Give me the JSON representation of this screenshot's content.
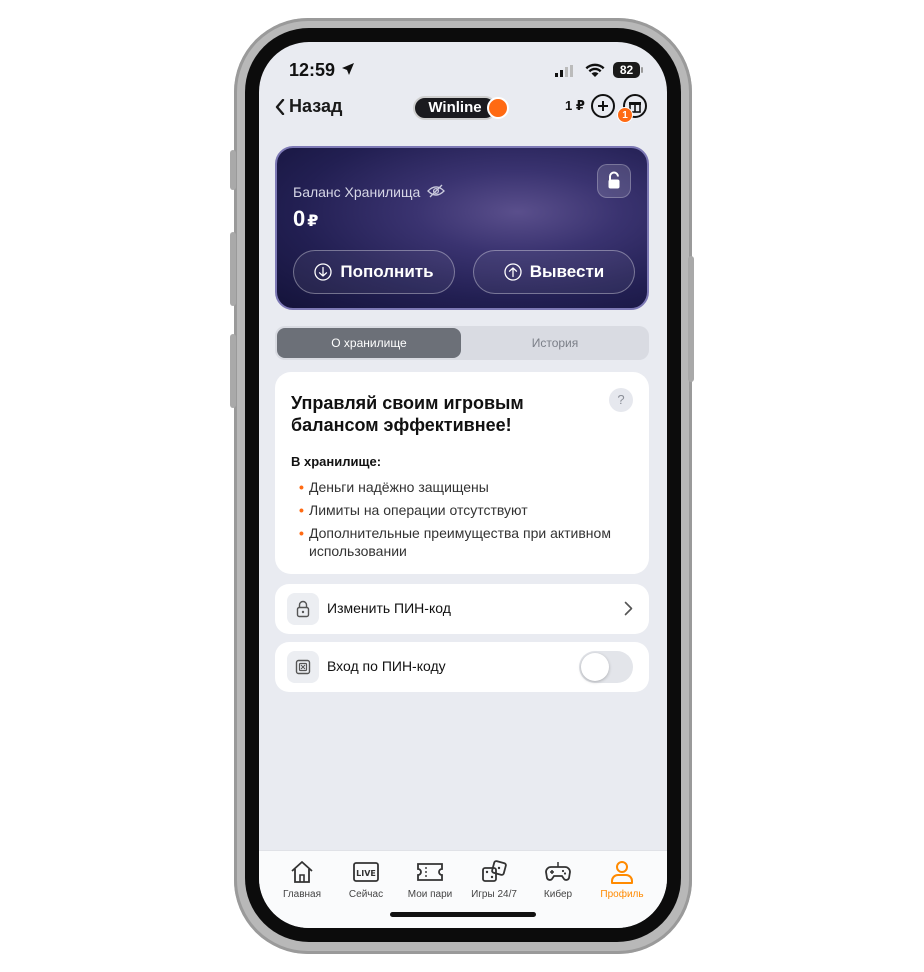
{
  "status_bar": {
    "time": "12:59",
    "battery": "82"
  },
  "header": {
    "back_label": "Назад",
    "logo_text": "Winline",
    "balance": "1 ₽",
    "notification_count": "1"
  },
  "vault": {
    "label": "Баланс Хранилища",
    "amount": "0",
    "currency": "₽",
    "deposit_label": "Пополнить",
    "withdraw_label": "Вывести"
  },
  "tabs": [
    {
      "label": "О хранилище",
      "active": true
    },
    {
      "label": "История",
      "active": false
    }
  ],
  "info": {
    "title": "Управляй своим игровым балансом эффективнее!",
    "help": "?",
    "subtitle": "В хранилище:",
    "items": [
      "Деньги надёжно защищены",
      "Лимиты на операции отсутствуют",
      "Дополнительные преимущества при активном использовании"
    ]
  },
  "settings": {
    "change_pin_label": "Изменить ПИН-код",
    "pin_login_label": "Вход по ПИН-коду",
    "pin_login_enabled": false
  },
  "nav": [
    {
      "label": "Главная",
      "icon": "home-icon",
      "active": false
    },
    {
      "label": "Сейчас",
      "icon": "live-icon",
      "badge": "LIVE",
      "active": false
    },
    {
      "label": "Мои пари",
      "icon": "ticket-icon",
      "active": false
    },
    {
      "label": "Игры 24/7",
      "icon": "dice-icon",
      "active": false
    },
    {
      "label": "Кибер",
      "icon": "gamepad-icon",
      "active": false
    },
    {
      "label": "Профиль",
      "icon": "profile-icon",
      "active": true
    }
  ],
  "colors": {
    "accent": "#ff6a13",
    "nav_active": "#ff8a00",
    "card_bg": "#221f52"
  }
}
